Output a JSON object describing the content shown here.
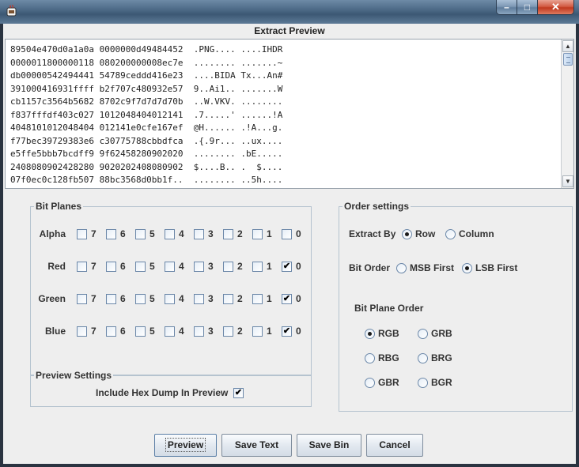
{
  "window": {
    "app_icon": "java-cup-icon",
    "minimize": "–",
    "maximize": "□",
    "close": "✕"
  },
  "preview": {
    "title": "Extract Preview",
    "lines": [
      "89504e470d0a1a0a 0000000d49484452  .PNG.... ....IHDR",
      "0000011800000118 080200000008ec7e  ........ .......~",
      "db00000542494441 54789ceddd416e23  ....BIDA Tx...An#",
      "391000416931ffff b2f707c480932e57  9..Ai1.. .......W",
      "cb1157c3564b5682 8702c9f7d7d7d70b  ..W.VKV. ........",
      "f837fffdf403c027 1012048404012141  .7.....' ......!A",
      "4048101012048404 012141e0cfe167ef  @H...... .!A...g.",
      "f77bec39729383e6 c30775788cbbdfca  .{.9r... ..ux....",
      "e5ffe5bbb7bcdff9 9f62458280902020  ........ .bE.....",
      "2408080902428280 9020202408080902  $....B.. .  $....",
      "07f0ec0c128fb507 88bc3568d0bb1f..  ........ ..5h...."
    ]
  },
  "bit_planes": {
    "legend": "Bit Planes",
    "bits": [
      "7",
      "6",
      "5",
      "4",
      "3",
      "2",
      "1",
      "0"
    ],
    "rows": [
      {
        "label": "Alpha",
        "checked": [
          false,
          false,
          false,
          false,
          false,
          false,
          false,
          false
        ]
      },
      {
        "label": "Red",
        "checked": [
          false,
          false,
          false,
          false,
          false,
          false,
          false,
          true
        ]
      },
      {
        "label": "Green",
        "checked": [
          false,
          false,
          false,
          false,
          false,
          false,
          false,
          true
        ]
      },
      {
        "label": "Blue",
        "checked": [
          false,
          false,
          false,
          false,
          false,
          false,
          false,
          true
        ]
      }
    ]
  },
  "preview_settings": {
    "legend": "Preview Settings",
    "hex_dump_label": "Include Hex Dump In Preview",
    "hex_dump_checked": true
  },
  "order_settings": {
    "legend": "Order settings",
    "extract_by_label": "Extract By",
    "extract_by_options": [
      "Row",
      "Column"
    ],
    "extract_by_selected": "Row",
    "bit_order_label": "Bit Order",
    "bit_order_options": [
      "MSB First",
      "LSB First"
    ],
    "bit_order_selected": "LSB First",
    "plane_order_label": "Bit Plane Order",
    "plane_order_options": [
      "RGB",
      "GRB",
      "RBG",
      "BRG",
      "GBR",
      "BGR"
    ],
    "plane_order_selected": "RGB"
  },
  "buttons": {
    "preview": "Preview",
    "save_text": "Save Text",
    "save_bin": "Save Bin",
    "cancel": "Cancel"
  }
}
